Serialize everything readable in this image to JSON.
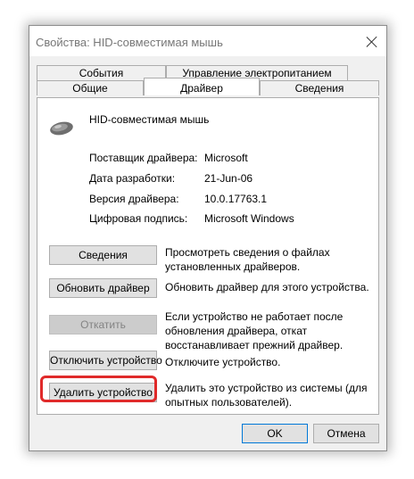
{
  "window": {
    "title": "Свойства: HID-совместимая мышь"
  },
  "tabs": {
    "row1": [
      {
        "label": "События"
      },
      {
        "label": "Управление электропитанием"
      }
    ],
    "row2": [
      {
        "label": "Общие"
      },
      {
        "label": "Драйвер",
        "active": true
      },
      {
        "label": "Сведения"
      }
    ]
  },
  "device": {
    "icon": "mouse-icon",
    "name": "HID-совместимая мышь"
  },
  "info": [
    {
      "label": "Поставщик драйвера:",
      "value": "Microsoft"
    },
    {
      "label": "Дата разработки:",
      "value": "21-Jun-06"
    },
    {
      "label": "Версия драйвера:",
      "value": "10.0.17763.1"
    },
    {
      "label": "Цифровая подпись:",
      "value": "Microsoft Windows"
    }
  ],
  "actions": [
    {
      "button": "Сведения",
      "desc_lines": [
        "Просмотреть сведения о файлах",
        "установленных драйверов."
      ],
      "enabled": true
    },
    {
      "button": "Обновить драйвер",
      "desc_lines": [
        "Обновить драйвер для этого устройства."
      ],
      "enabled": true
    },
    {
      "button": "Откатить",
      "desc_lines": [
        "Если устройство не работает после",
        "обновления драйвера, откат",
        "восстанавливает прежний драйвер."
      ],
      "enabled": false
    },
    {
      "button": "Отключить устройство",
      "desc_lines": [
        "Отключите устройство."
      ],
      "enabled": true
    },
    {
      "button": "Удалить устройство",
      "desc_lines": [
        "Удалить это устройство из системы (для",
        "опытных пользователей)."
      ],
      "enabled": true,
      "highlighted": true
    }
  ],
  "footer": {
    "ok_label": "OK",
    "cancel_label": "Отмена"
  },
  "colors": {
    "highlight": "#e02a2a",
    "ok_border": "#0078d7"
  }
}
